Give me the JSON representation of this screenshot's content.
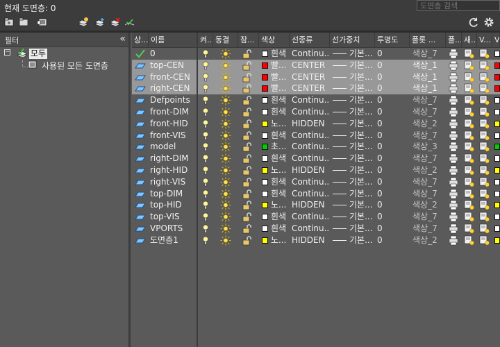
{
  "window": {
    "title": "현재 도면층: 0",
    "search_placeholder": "도면층 검색"
  },
  "filter_panel": {
    "title": "필터",
    "collapse_glyph": "«",
    "tree": {
      "root": {
        "expander": "−",
        "label": "모두"
      },
      "child": {
        "label": "사용된 모든 도면층"
      }
    }
  },
  "columns": [
    {
      "label": "상..."
    },
    {
      "label": "이름"
    },
    {
      "label": "켜..."
    },
    {
      "label": "동결"
    },
    {
      "label": "잠..."
    },
    {
      "label": "색상"
    },
    {
      "label": "선종류"
    },
    {
      "label": "선가중치"
    },
    {
      "label": "투명도"
    },
    {
      "label": "플롯 ..."
    },
    {
      "label": "플..."
    },
    {
      "label": "새..."
    },
    {
      "label": "V..."
    },
    {
      "label": "V..."
    }
  ],
  "layers": [
    {
      "name": "0",
      "status": "current",
      "color_name": "흰색",
      "color_hex": "#ffffff",
      "linetype": "Continu...",
      "lineweight": "기본...",
      "transparency": "0",
      "plot_style": "색상_7",
      "selected": false
    },
    {
      "name": "top-CEN",
      "status": "normal",
      "color_name": "빨...",
      "color_hex": "#ff0000",
      "linetype": "CENTER",
      "lineweight": "기본...",
      "transparency": "0",
      "plot_style": "색상_1",
      "selected": true
    },
    {
      "name": "front-CEN",
      "status": "normal",
      "color_name": "빨...",
      "color_hex": "#ff0000",
      "linetype": "CENTER",
      "lineweight": "기본...",
      "transparency": "0",
      "plot_style": "색상_1",
      "selected": true
    },
    {
      "name": "right-CEN",
      "status": "normal",
      "color_name": "빨...",
      "color_hex": "#ff0000",
      "linetype": "CENTER",
      "lineweight": "기본...",
      "transparency": "0",
      "plot_style": "색상_1",
      "selected": true
    },
    {
      "name": "Defpoints",
      "status": "normal",
      "color_name": "흰색",
      "color_hex": "#ffffff",
      "linetype": "Continu...",
      "lineweight": "기본...",
      "transparency": "0",
      "plot_style": "색상_7",
      "selected": false
    },
    {
      "name": "front-DIM",
      "status": "normal",
      "color_name": "흰색",
      "color_hex": "#ffffff",
      "linetype": "Continu...",
      "lineweight": "기본...",
      "transparency": "0",
      "plot_style": "색상_7",
      "selected": false
    },
    {
      "name": "front-HID",
      "status": "normal",
      "color_name": "노...",
      "color_hex": "#ffff00",
      "linetype": "HIDDEN",
      "lineweight": "기본...",
      "transparency": "0",
      "plot_style": "색상_2",
      "selected": false
    },
    {
      "name": "front-VIS",
      "status": "normal",
      "color_name": "흰색",
      "color_hex": "#ffffff",
      "linetype": "Continu...",
      "lineweight": "기본...",
      "transparency": "0",
      "plot_style": "색상_7",
      "selected": false
    },
    {
      "name": "model",
      "status": "normal",
      "color_name": "초...",
      "color_hex": "#00cc00",
      "linetype": "Continu...",
      "lineweight": "기본...",
      "transparency": "0",
      "plot_style": "색상_3",
      "selected": false
    },
    {
      "name": "right-DIM",
      "status": "normal",
      "color_name": "흰색",
      "color_hex": "#ffffff",
      "linetype": "Continu...",
      "lineweight": "기본...",
      "transparency": "0",
      "plot_style": "색상_7",
      "selected": false
    },
    {
      "name": "right-HID",
      "status": "normal",
      "color_name": "노...",
      "color_hex": "#ffff00",
      "linetype": "HIDDEN",
      "lineweight": "기본...",
      "transparency": "0",
      "plot_style": "색상_2",
      "selected": false
    },
    {
      "name": "right-VIS",
      "status": "normal",
      "color_name": "흰색",
      "color_hex": "#ffffff",
      "linetype": "Continu...",
      "lineweight": "기본...",
      "transparency": "0",
      "plot_style": "색상_7",
      "selected": false
    },
    {
      "name": "top-DIM",
      "status": "normal",
      "color_name": "흰색",
      "color_hex": "#ffffff",
      "linetype": "Continu...",
      "lineweight": "기본...",
      "transparency": "0",
      "plot_style": "색상_7",
      "selected": false
    },
    {
      "name": "top-HID",
      "status": "normal",
      "color_name": "노...",
      "color_hex": "#ffff00",
      "linetype": "HIDDEN",
      "lineweight": "기본...",
      "transparency": "0",
      "plot_style": "색상_2",
      "selected": false
    },
    {
      "name": "top-VIS",
      "status": "normal",
      "color_name": "흰색",
      "color_hex": "#ffffff",
      "linetype": "Continu...",
      "lineweight": "기본...",
      "transparency": "0",
      "plot_style": "색상_7",
      "selected": false
    },
    {
      "name": "VPORTS",
      "status": "normal",
      "color_name": "흰색",
      "color_hex": "#ffffff",
      "linetype": "Continu...",
      "lineweight": "기본...",
      "transparency": "0",
      "plot_style": "색상_7",
      "selected": false
    },
    {
      "name": "도면층1",
      "status": "normal",
      "color_name": "노...",
      "color_hex": "#ffff00",
      "linetype": "HIDDEN",
      "lineweight": "기본...",
      "transparency": "0",
      "plot_style": "색상_2",
      "selected": false
    }
  ],
  "icons": {
    "toolbar": [
      "new-property-filter-icon",
      "new-group-filter-icon",
      "layer-states-manager-icon",
      "new-layer-icon",
      "new-layer-vp-frozen-icon",
      "delete-layer-icon",
      "set-current-icon",
      "refresh-icon",
      "settings-icon"
    ],
    "row": [
      "layer-status-icon",
      "lightbulb-on-icon",
      "sun-thawed-icon",
      "lock-open-icon",
      "printer-icon",
      "new-vp-freeze-icon",
      "vp-freeze-icon",
      "vp-color-icon"
    ]
  },
  "colors": {
    "selected_row": "#989898",
    "panel_bg": "#5a5a5a",
    "header_bg": "#4a4a4a",
    "titlebar_bg": "#3c3c3c"
  }
}
